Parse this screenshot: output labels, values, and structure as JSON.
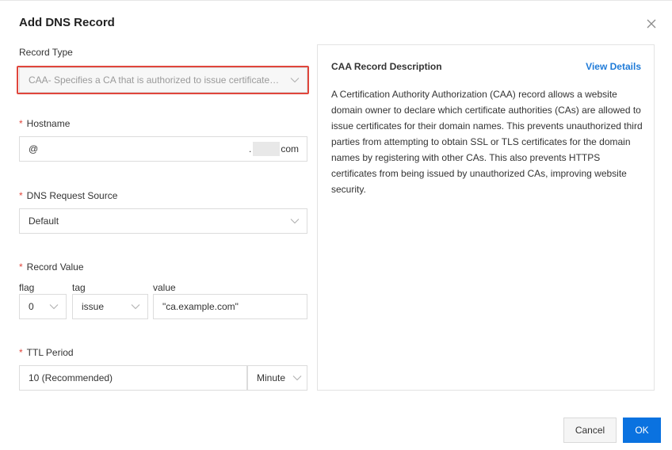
{
  "dialog": {
    "title": "Add DNS Record",
    "close_icon": "close-icon"
  },
  "form": {
    "record_type": {
      "label": "Record Type",
      "value": "CAA- Specifies a CA that is authorized to issue certificates f..."
    },
    "hostname": {
      "label": "Hostname",
      "value": "@",
      "suffix_start": ".",
      "suffix_end": "com"
    },
    "dns_request_source": {
      "label": "DNS Request Source",
      "value": "Default"
    },
    "record_value": {
      "label": "Record Value",
      "flag_label": "flag",
      "flag_value": "0",
      "tag_label": "tag",
      "tag_value": "issue",
      "value_label": "value",
      "value_value": "\"ca.example.com\""
    },
    "ttl": {
      "label": "TTL Period",
      "value": "10 (Recommended)",
      "unit": "Minute"
    },
    "required_mark": "*"
  },
  "description": {
    "title": "CAA Record Description",
    "link": "View Details",
    "body": "A Certification Authority Authorization (CAA) record allows a website domain owner to declare which certificate authorities (CAs) are allowed to issue certificates for their domain names. This prevents unauthorized third parties from attempting to obtain SSL or TLS certificates for the domain names by registering with other CAs. This also prevents HTTPS certificates from being issued by unauthorized CAs, improving website security."
  },
  "footer": {
    "cancel_label": "Cancel",
    "ok_label": "OK"
  },
  "colors": {
    "accent": "#0a72e0",
    "link": "#1f7bd8",
    "required": "#e0463c",
    "highlight": "#e0463c"
  }
}
